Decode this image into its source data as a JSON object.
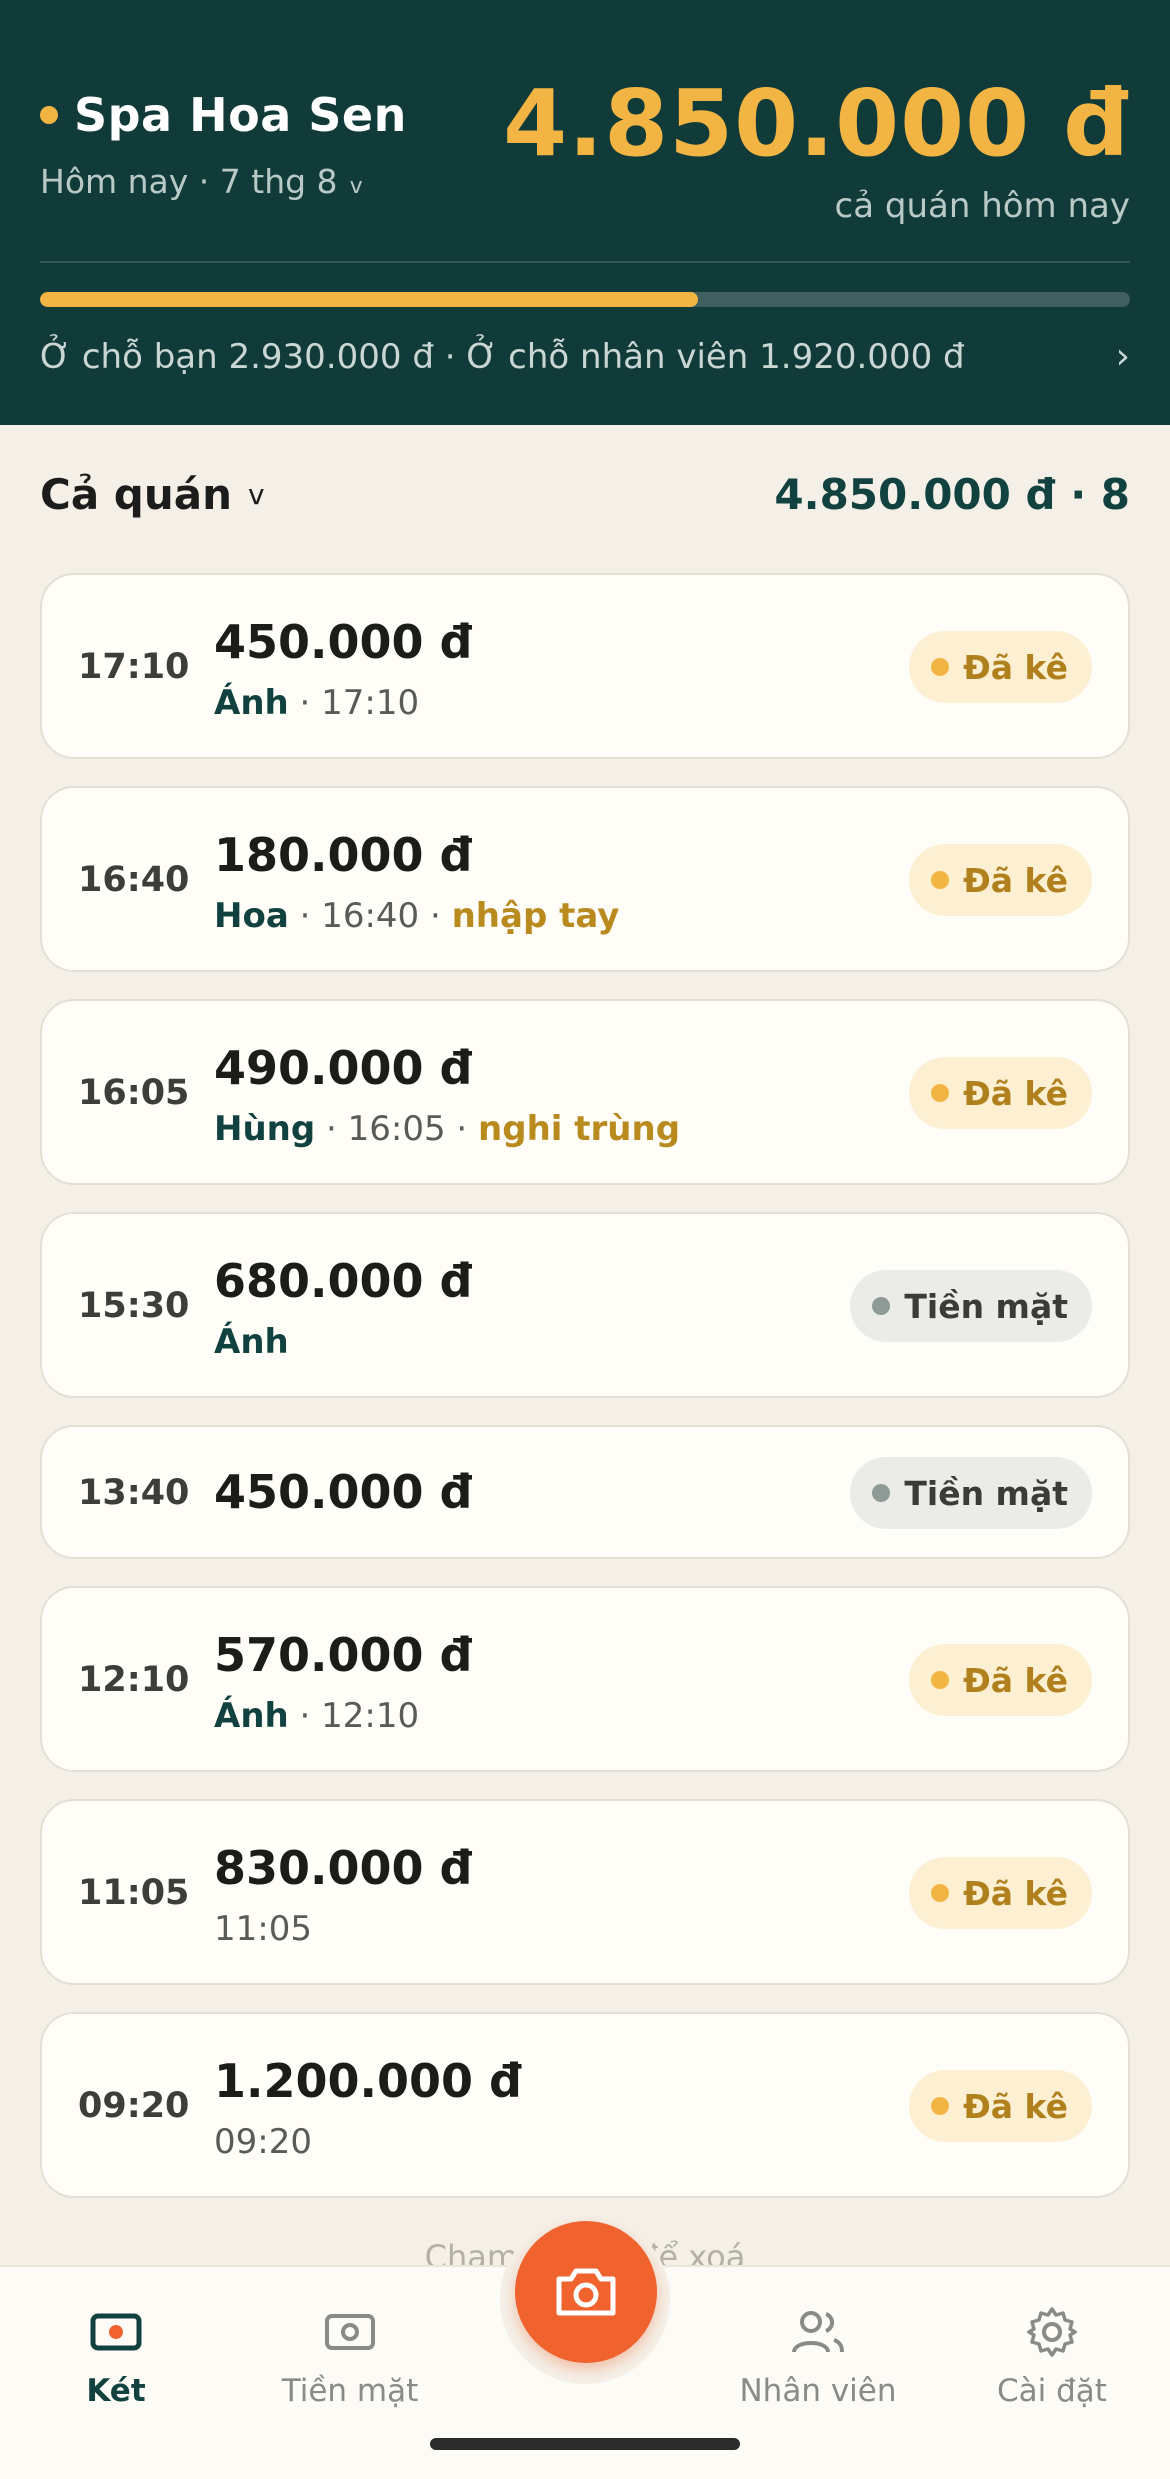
{
  "header": {
    "shop_name": "Spa Hoa Sen",
    "date_label": "Hôm nay · 7 thg 8",
    "date_chevron": "v",
    "total_amount": "4.850.000 đ",
    "total_sub": "cả quán hôm nay",
    "progress_fraction": 0.604,
    "split_text": "Ở chỗ bạn 2.930.000 đ · Ở chỗ nhân viên 1.920.000 đ",
    "chevron_right": "›"
  },
  "filter": {
    "title": "Cả quán",
    "chevron": "v",
    "summary": "4.850.000 đ · 8"
  },
  "transactions": [
    {
      "time": "17:10",
      "amount": "450.000 đ",
      "who": "Ánh",
      "meta": " · 17:10",
      "warn": "",
      "status": "Đã kê"
    },
    {
      "time": "16:40",
      "amount": "180.000 đ",
      "who": "Hoa",
      "meta": " · 16:40 · ",
      "warn": "nhập tay",
      "status": "Đã kê"
    },
    {
      "time": "16:05",
      "amount": "490.000 đ",
      "who": "Hùng",
      "meta": " · 16:05 · ",
      "warn": "nghi trùng",
      "status": "Đã kê"
    },
    {
      "time": "15:30",
      "amount": "680.000 đ",
      "who": "Ánh",
      "meta": "",
      "warn": "",
      "status": "Tiền mặt"
    },
    {
      "time": "13:40",
      "amount": "450.000 đ",
      "who": "",
      "meta": "",
      "warn": "",
      "status": "Tiền mặt"
    },
    {
      "time": "12:10",
      "amount": "570.000 đ",
      "who": "Ánh",
      "meta": " · 12:10",
      "warn": "",
      "status": "Đã kê"
    },
    {
      "time": "11:05",
      "amount": "830.000 đ",
      "who": "",
      "meta": "11:05",
      "warn": "",
      "status": "Đã kê"
    },
    {
      "time": "09:20",
      "amount": "1.200.000 đ",
      "who": "",
      "meta": "09:20",
      "warn": "",
      "status": "Đã kê"
    }
  ],
  "hint": "Chạm để giữ để xoá",
  "nav": {
    "items": [
      {
        "label": "Két",
        "icon": "cashbox-icon"
      },
      {
        "label": "Tiền mặt",
        "icon": "cash-icon"
      },
      {
        "label": "Nhân viên",
        "icon": "people-icon"
      },
      {
        "label": "Cài đặt",
        "icon": "gear-icon"
      }
    ],
    "fab_icon": "camera-icon"
  },
  "colors": {
    "header_bg": "#113b39",
    "accent": "#f2b544",
    "fab": "#f0632e",
    "page_bg": "#f4f0e8"
  }
}
